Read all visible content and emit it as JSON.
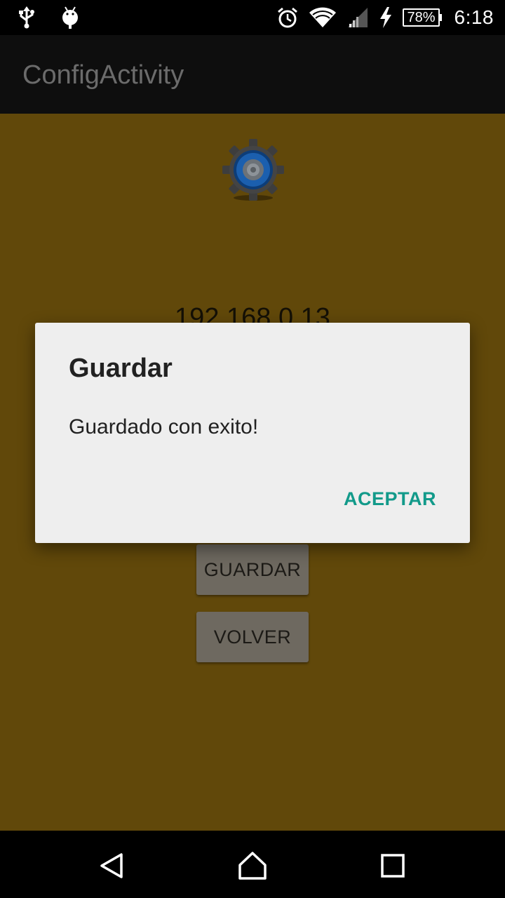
{
  "status_bar": {
    "icons_left": [
      "usb-icon",
      "android-debug-icon"
    ],
    "icons_right": [
      "alarm-icon",
      "wifi-icon",
      "signal-icon",
      "charging-icon"
    ],
    "battery_label": "78%",
    "time": "6:18"
  },
  "action_bar": {
    "title": "ConfigActivity"
  },
  "content": {
    "ip_value": "192.168.0.13",
    "guardar_button": "GUARDAR",
    "volver_button": "VOLVER"
  },
  "dialog": {
    "title": "Guardar",
    "message": "Guardado con exito!",
    "accept_button": "ACEPTAR"
  },
  "colors": {
    "content_background": "#61480a",
    "accent": "#129a8a",
    "dialog_background": "#eeeeee"
  }
}
